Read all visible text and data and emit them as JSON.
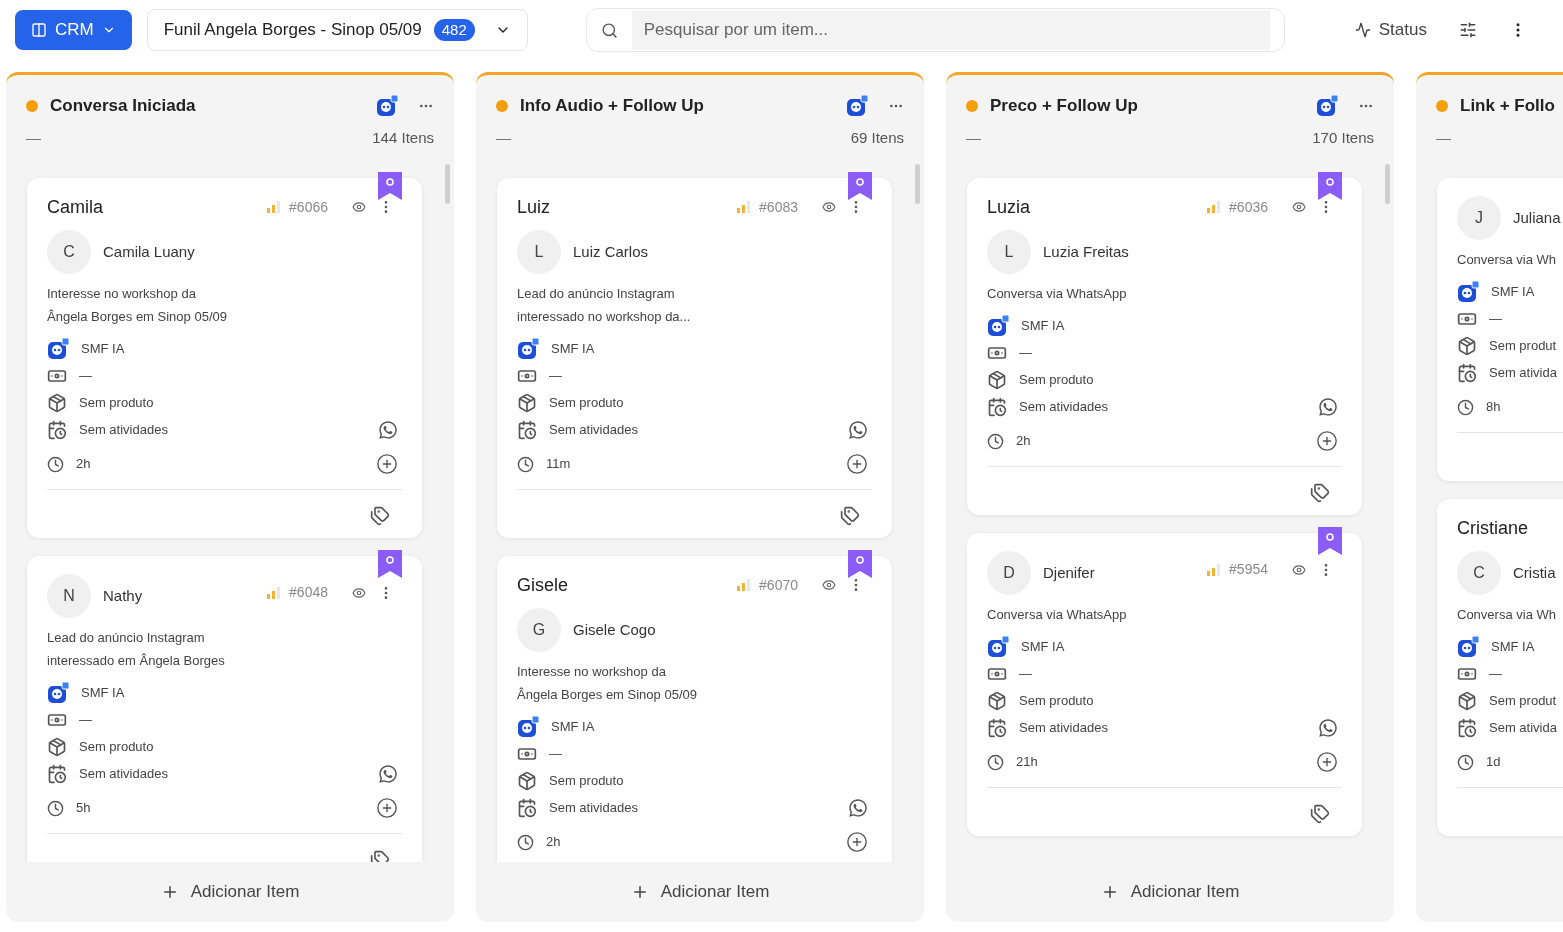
{
  "header": {
    "app_button": "CRM",
    "funnel": {
      "name": "Funil Angela Borges - Sinop 05/09",
      "count": "482"
    },
    "search": {
      "placeholder": "Pesquisar por um item..."
    },
    "status_button": "Status"
  },
  "columns": [
    {
      "title": "Conversa Iniciada",
      "value": "—",
      "count": "144 Itens",
      "add_label": "Adicionar Item",
      "cards": [
        {
          "title": "Camila",
          "contact": {
            "initial": "C",
            "name": "Camila Luany"
          },
          "id": "#6066",
          "description": [
            "Interesse no workshop da",
            "Ângela Borges em Sinop 05/09"
          ],
          "agent": "SMF IA",
          "amount": "—",
          "product": "Sem produto",
          "activities": "Sem atividades",
          "age": "2h"
        },
        {
          "contact": {
            "initial": "N",
            "name": "Nathy"
          },
          "id": "#6048",
          "description": [
            "Lead do anúncio Instagram",
            "interessado em Ângela Borges"
          ],
          "agent": "SMF IA",
          "amount": "—",
          "product": "Sem produto",
          "activities": "Sem atividades",
          "age": "5h"
        }
      ]
    },
    {
      "title": "Info Audio + Follow Up",
      "value": "—",
      "count": "69 Itens",
      "add_label": "Adicionar Item",
      "cards": [
        {
          "title": "Luiz",
          "contact": {
            "initial": "L",
            "name": "Luiz Carlos"
          },
          "id": "#6083",
          "description": [
            "Lead do anúncio Instagram",
            "interessado no workshop da..."
          ],
          "agent": "SMF IA",
          "amount": "—",
          "product": "Sem produto",
          "activities": "Sem atividades",
          "age": "11m"
        },
        {
          "title": "Gisele",
          "contact": {
            "initial": "G",
            "name": "Gisele Cogo"
          },
          "id": "#6070",
          "description": [
            "Interesse no workshop da",
            "Ângela Borges em Sinop 05/09"
          ],
          "agent": "SMF IA",
          "amount": "—",
          "product": "Sem produto",
          "activities": "Sem atividades",
          "age": "2h"
        }
      ]
    },
    {
      "title": "Preco + Follow Up",
      "value": "—",
      "count": "170 Itens",
      "add_label": "Adicionar Item",
      "cards": [
        {
          "title": "Luzia",
          "contact": {
            "initial": "L",
            "name": "Luzia Freitas"
          },
          "id": "#6036",
          "description": [
            "Conversa via WhatsApp"
          ],
          "agent": "SMF IA",
          "amount": "—",
          "product": "Sem produto",
          "activities": "Sem atividades",
          "age": "2h"
        },
        {
          "contact": {
            "initial": "D",
            "name": "Djenifer"
          },
          "id": "#5954",
          "description": [
            "Conversa via WhatsApp"
          ],
          "agent": "SMF IA",
          "amount": "—",
          "product": "Sem produto",
          "activities": "Sem atividades",
          "age": "21h"
        }
      ]
    },
    {
      "title": "Link + Follo",
      "value": "—",
      "cards": [
        {
          "contact": {
            "initial": "J",
            "name": "Juliana"
          },
          "description": [
            "Conversa via Wh"
          ],
          "agent": "SMF IA",
          "amount": "—",
          "product": "Sem produt",
          "activities": "Sem ativida",
          "age": "8h"
        },
        {
          "title": "Cristiane",
          "contact": {
            "initial": "C",
            "name": "Cristia"
          },
          "description": [
            "Conversa via Wh"
          ],
          "agent": "SMF IA",
          "amount": "—",
          "product": "Sem produt",
          "activities": "Sem ativida",
          "age": "1d"
        }
      ]
    }
  ]
}
